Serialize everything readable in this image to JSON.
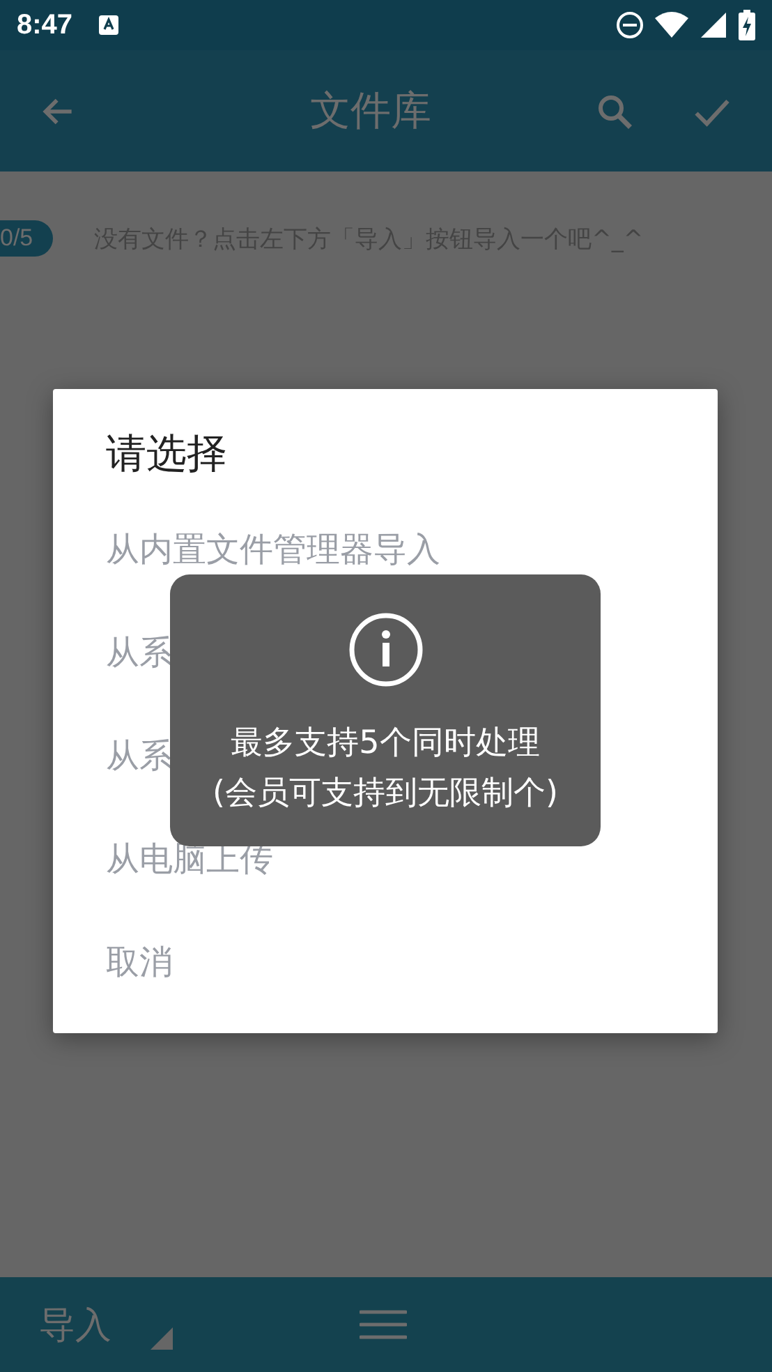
{
  "status_bar": {
    "time": "8:47"
  },
  "app_bar": {
    "title": "文件库"
  },
  "content": {
    "counter": "0/5",
    "hint": "没有文件？点击左下方「导入」按钮导入一个吧^_^"
  },
  "dialog": {
    "title": "请选择",
    "options": [
      "从内置文件管理器导入",
      "从系",
      "从系",
      "从电脑上传",
      "取消"
    ]
  },
  "toast": {
    "lines": [
      "最多支持5个同时处理",
      "(会员可支持到无限制个)"
    ]
  },
  "bottom_bar": {
    "import_label": "导入"
  }
}
